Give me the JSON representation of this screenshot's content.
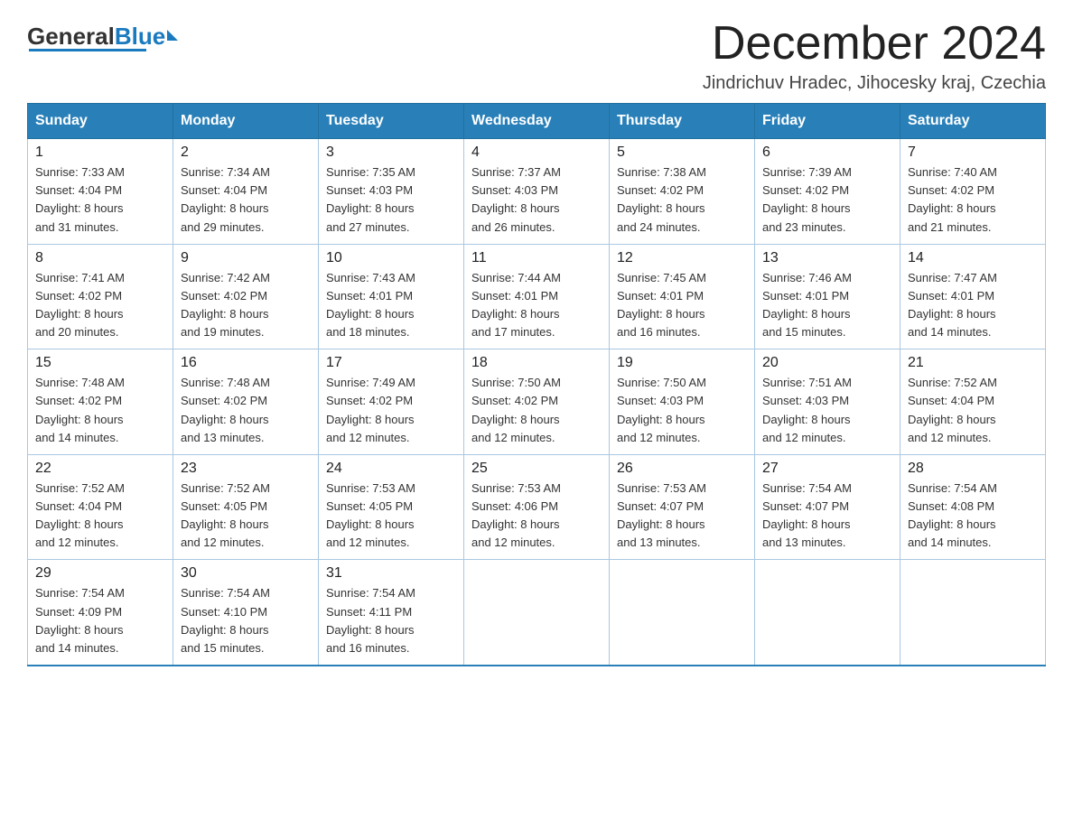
{
  "header": {
    "logo": {
      "general": "General",
      "blue": "Blue"
    },
    "title": "December 2024",
    "location": "Jindrichuv Hradec, Jihocesky kraj, Czechia"
  },
  "days_of_week": [
    "Sunday",
    "Monday",
    "Tuesday",
    "Wednesday",
    "Thursday",
    "Friday",
    "Saturday"
  ],
  "weeks": [
    [
      {
        "day": "1",
        "sunrise": "7:33 AM",
        "sunset": "4:04 PM",
        "daylight": "8 hours and 31 minutes."
      },
      {
        "day": "2",
        "sunrise": "7:34 AM",
        "sunset": "4:04 PM",
        "daylight": "8 hours and 29 minutes."
      },
      {
        "day": "3",
        "sunrise": "7:35 AM",
        "sunset": "4:03 PM",
        "daylight": "8 hours and 27 minutes."
      },
      {
        "day": "4",
        "sunrise": "7:37 AM",
        "sunset": "4:03 PM",
        "daylight": "8 hours and 26 minutes."
      },
      {
        "day": "5",
        "sunrise": "7:38 AM",
        "sunset": "4:02 PM",
        "daylight": "8 hours and 24 minutes."
      },
      {
        "day": "6",
        "sunrise": "7:39 AM",
        "sunset": "4:02 PM",
        "daylight": "8 hours and 23 minutes."
      },
      {
        "day": "7",
        "sunrise": "7:40 AM",
        "sunset": "4:02 PM",
        "daylight": "8 hours and 21 minutes."
      }
    ],
    [
      {
        "day": "8",
        "sunrise": "7:41 AM",
        "sunset": "4:02 PM",
        "daylight": "8 hours and 20 minutes."
      },
      {
        "day": "9",
        "sunrise": "7:42 AM",
        "sunset": "4:02 PM",
        "daylight": "8 hours and 19 minutes."
      },
      {
        "day": "10",
        "sunrise": "7:43 AM",
        "sunset": "4:01 PM",
        "daylight": "8 hours and 18 minutes."
      },
      {
        "day": "11",
        "sunrise": "7:44 AM",
        "sunset": "4:01 PM",
        "daylight": "8 hours and 17 minutes."
      },
      {
        "day": "12",
        "sunrise": "7:45 AM",
        "sunset": "4:01 PM",
        "daylight": "8 hours and 16 minutes."
      },
      {
        "day": "13",
        "sunrise": "7:46 AM",
        "sunset": "4:01 PM",
        "daylight": "8 hours and 15 minutes."
      },
      {
        "day": "14",
        "sunrise": "7:47 AM",
        "sunset": "4:01 PM",
        "daylight": "8 hours and 14 minutes."
      }
    ],
    [
      {
        "day": "15",
        "sunrise": "7:48 AM",
        "sunset": "4:02 PM",
        "daylight": "8 hours and 14 minutes."
      },
      {
        "day": "16",
        "sunrise": "7:48 AM",
        "sunset": "4:02 PM",
        "daylight": "8 hours and 13 minutes."
      },
      {
        "day": "17",
        "sunrise": "7:49 AM",
        "sunset": "4:02 PM",
        "daylight": "8 hours and 12 minutes."
      },
      {
        "day": "18",
        "sunrise": "7:50 AM",
        "sunset": "4:02 PM",
        "daylight": "8 hours and 12 minutes."
      },
      {
        "day": "19",
        "sunrise": "7:50 AM",
        "sunset": "4:03 PM",
        "daylight": "8 hours and 12 minutes."
      },
      {
        "day": "20",
        "sunrise": "7:51 AM",
        "sunset": "4:03 PM",
        "daylight": "8 hours and 12 minutes."
      },
      {
        "day": "21",
        "sunrise": "7:52 AM",
        "sunset": "4:04 PM",
        "daylight": "8 hours and 12 minutes."
      }
    ],
    [
      {
        "day": "22",
        "sunrise": "7:52 AM",
        "sunset": "4:04 PM",
        "daylight": "8 hours and 12 minutes."
      },
      {
        "day": "23",
        "sunrise": "7:52 AM",
        "sunset": "4:05 PM",
        "daylight": "8 hours and 12 minutes."
      },
      {
        "day": "24",
        "sunrise": "7:53 AM",
        "sunset": "4:05 PM",
        "daylight": "8 hours and 12 minutes."
      },
      {
        "day": "25",
        "sunrise": "7:53 AM",
        "sunset": "4:06 PM",
        "daylight": "8 hours and 12 minutes."
      },
      {
        "day": "26",
        "sunrise": "7:53 AM",
        "sunset": "4:07 PM",
        "daylight": "8 hours and 13 minutes."
      },
      {
        "day": "27",
        "sunrise": "7:54 AM",
        "sunset": "4:07 PM",
        "daylight": "8 hours and 13 minutes."
      },
      {
        "day": "28",
        "sunrise": "7:54 AM",
        "sunset": "4:08 PM",
        "daylight": "8 hours and 14 minutes."
      }
    ],
    [
      {
        "day": "29",
        "sunrise": "7:54 AM",
        "sunset": "4:09 PM",
        "daylight": "8 hours and 14 minutes."
      },
      {
        "day": "30",
        "sunrise": "7:54 AM",
        "sunset": "4:10 PM",
        "daylight": "8 hours and 15 minutes."
      },
      {
        "day": "31",
        "sunrise": "7:54 AM",
        "sunset": "4:11 PM",
        "daylight": "8 hours and 16 minutes."
      },
      null,
      null,
      null,
      null
    ]
  ],
  "labels": {
    "sunrise": "Sunrise:",
    "sunset": "Sunset:",
    "daylight": "Daylight:"
  }
}
